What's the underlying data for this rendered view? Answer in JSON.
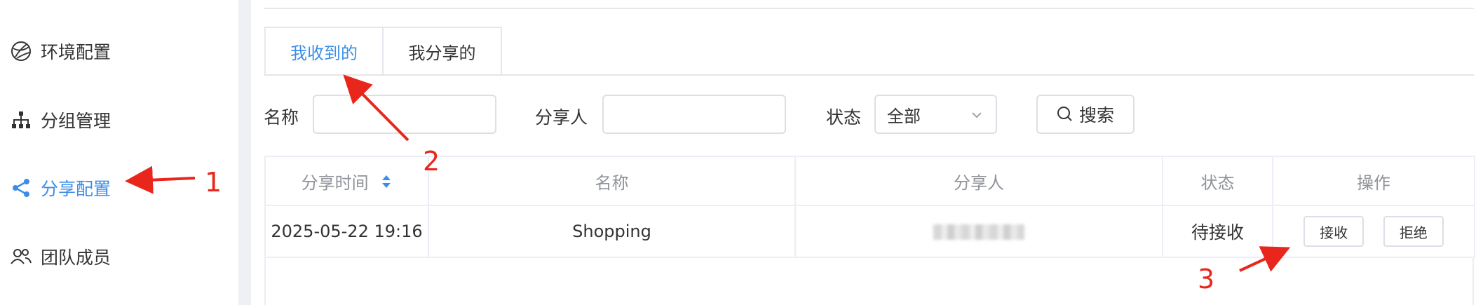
{
  "sidebar": {
    "items": [
      {
        "label": "环境配置",
        "icon": "globe-icon",
        "active": false
      },
      {
        "label": "分组管理",
        "icon": "org-tree-icon",
        "active": false
      },
      {
        "label": "分享配置",
        "icon": "share-icon",
        "active": true
      },
      {
        "label": "团队成员",
        "icon": "team-icon",
        "active": false
      }
    ]
  },
  "tabs": [
    {
      "label": "我收到的",
      "active": true
    },
    {
      "label": "我分享的",
      "active": false
    }
  ],
  "filters": {
    "name_label": "名称",
    "name_value": "",
    "sharer_label": "分享人",
    "sharer_value": "",
    "status_label": "状态",
    "status_selected": "全部",
    "search_label": "搜索"
  },
  "table": {
    "columns": [
      "分享时间",
      "名称",
      "分享人",
      "状态",
      "操作"
    ],
    "rows": [
      {
        "time": "2025-05-22 19:16",
        "name": "Shopping",
        "sharer": "",
        "status": "待接收",
        "actions": [
          "接收",
          "拒绝"
        ]
      }
    ]
  },
  "annotations": [
    "1",
    "2",
    "3"
  ],
  "colors": {
    "accent": "#3a8ee6",
    "annotation": "#e8261c"
  }
}
